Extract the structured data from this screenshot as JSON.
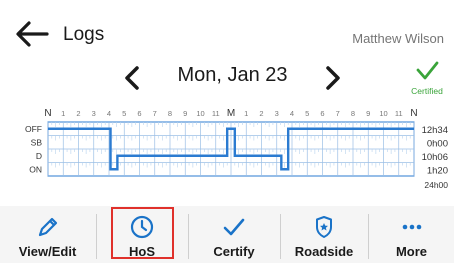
{
  "header": {
    "title": "Logs",
    "user_name": "Matthew Wilson"
  },
  "date_nav": {
    "date": "Mon, Jan 23",
    "status": "Certified"
  },
  "colors": {
    "accent": "#1a73c8",
    "grid_line": "#2b7bd1",
    "certified": "#3aa43a",
    "highlight": "#e0312b"
  },
  "chart_data": {
    "type": "line",
    "hour_labels": [
      "N",
      "1",
      "2",
      "3",
      "4",
      "5",
      "6",
      "7",
      "8",
      "9",
      "10",
      "11",
      "M",
      "1",
      "2",
      "3",
      "4",
      "5",
      "6",
      "7",
      "8",
      "9",
      "10",
      "11",
      "N"
    ],
    "rows": [
      "OFF",
      "SB",
      "D",
      "ON"
    ],
    "totals": [
      "12h34",
      "0h00",
      "10h06",
      "1h20"
    ],
    "total": "24h00",
    "duty_segments": [
      {
        "status": "OFF",
        "start": 0.0,
        "end": 4.1
      },
      {
        "status": "ON",
        "start": 4.1,
        "end": 4.55
      },
      {
        "status": "D",
        "start": 4.55,
        "end": 11.75
      },
      {
        "status": "OFF",
        "start": 11.75,
        "end": 12.25
      },
      {
        "status": "D",
        "start": 12.25,
        "end": 15.3
      },
      {
        "status": "ON",
        "start": 15.3,
        "end": 15.75
      },
      {
        "status": "OFF",
        "start": 15.75,
        "end": 24.0
      }
    ]
  },
  "toolbar": {
    "items": [
      {
        "label": "View/Edit",
        "icon": "pencil-icon"
      },
      {
        "label": "HoS",
        "icon": "clock-icon"
      },
      {
        "label": "Certify",
        "icon": "check-icon"
      },
      {
        "label": "Roadside",
        "icon": "badge-star-icon"
      },
      {
        "label": "More",
        "icon": "more-dots-icon"
      }
    ]
  }
}
